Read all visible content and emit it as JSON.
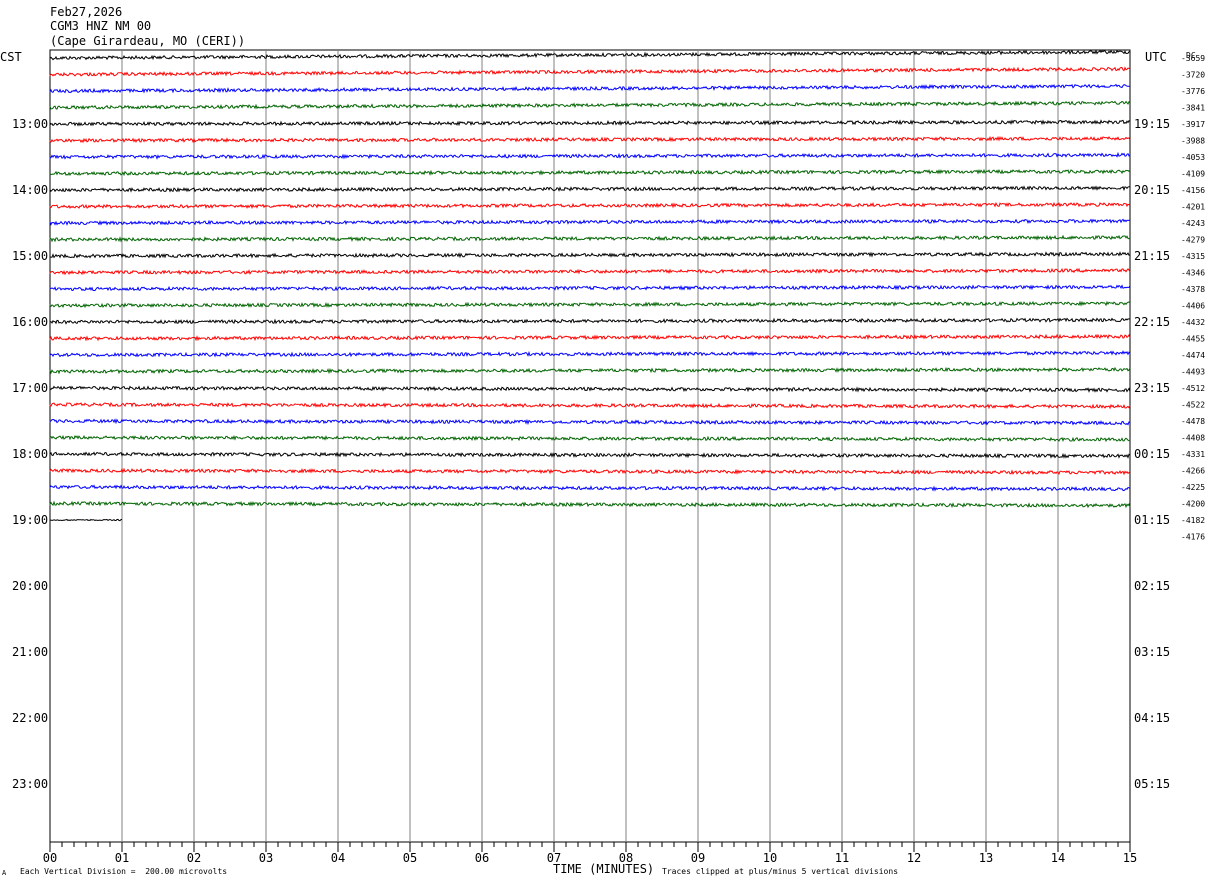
{
  "header": {
    "date": "Feb27,2026",
    "station": "CGM3 HNZ NM 00",
    "location": "(Cape Girardeau, MO (CERI))"
  },
  "footer": {
    "scale_note": "Each Vertical Division =  200.00 microvolts",
    "xlabel": "TIME (MINUTES)",
    "clip_note": "Traces clipped at plus/minus 5 vertical divisions",
    "corner_mark": "A"
  },
  "colors": {
    "trace_cycle": [
      "#000000",
      "#ff0000",
      "#0000ff",
      "#006400"
    ],
    "grid": "#808080"
  },
  "chart_data": {
    "type": "line",
    "left_axis_label": "CST",
    "right_axis_label": "UTC",
    "dc_label": "DC",
    "x_ticks": [
      "00",
      "01",
      "02",
      "03",
      "04",
      "05",
      "06",
      "07",
      "08",
      "09",
      "10",
      "11",
      "12",
      "13",
      "14",
      "15"
    ],
    "xlim": [
      0,
      15
    ],
    "left_hour_labels": [
      "13:00",
      "14:00",
      "15:00",
      "16:00",
      "17:00",
      "18:00",
      "19:00",
      "20:00",
      "21:00",
      "22:00",
      "23:00"
    ],
    "right_hour_labels": [
      "19:15",
      "20:15",
      "21:15",
      "22:15",
      "23:15",
      "00:15",
      "01:15",
      "02:15",
      "03:15",
      "04:15",
      "05:15"
    ],
    "dc_offsets": [
      "-3659",
      "-3720",
      "-3776",
      "-3841",
      "-3917",
      "-3988",
      "-4053",
      "-4109",
      "-4156",
      "-4201",
      "-4243",
      "-4279",
      "-4315",
      "-4346",
      "-4378",
      "-4406",
      "-4432",
      "-4455",
      "-4474",
      "-4493",
      "-4512",
      "-4522",
      "-4478",
      "-4408",
      "-4331",
      "-4266",
      "-4225",
      "-4200",
      "-4182",
      "-4176"
    ],
    "trace_count": 29,
    "last_trace_minutes": 1
  }
}
